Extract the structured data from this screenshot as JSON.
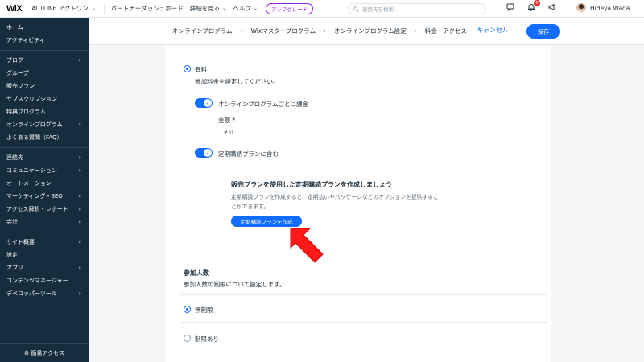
{
  "topbar": {
    "logo": "WiX",
    "site_name": "ACTONE アクトワン",
    "links": [
      "パートナーダッシュボード",
      "詳細を見る",
      "ヘルプ"
    ],
    "upgrade": "アップグレード",
    "search_placeholder": "連絡先を検索...",
    "notifications_count": "6",
    "user_name": "Hideya Wada"
  },
  "sidebar": {
    "group1": [
      "ホーム",
      "アクティビティ"
    ],
    "group2": [
      {
        "label": "ブログ",
        "arrow": true
      },
      {
        "label": "グループ",
        "arrow": false
      },
      {
        "label": "販売プラン",
        "arrow": false
      },
      {
        "label": "サブスクリプション",
        "arrow": false
      },
      {
        "label": "特典プログラム",
        "arrow": false
      },
      {
        "label": "オンラインプログラム",
        "arrow": true
      },
      {
        "label": "よくある質問（FAQ）",
        "arrow": false
      }
    ],
    "group3": [
      {
        "label": "連絡先",
        "arrow": true
      },
      {
        "label": "コミュニケーション",
        "arrow": true
      },
      {
        "label": "オートメーション",
        "arrow": false
      },
      {
        "label": "マーケティング・SEO",
        "arrow": true
      },
      {
        "label": "アクセス解析・レポート",
        "arrow": true
      },
      {
        "label": "会計",
        "arrow": true
      }
    ],
    "group4": [
      {
        "label": "サイト概要",
        "arrow": true
      },
      {
        "label": "設定",
        "arrow": false
      },
      {
        "label": "アプリ",
        "arrow": true
      },
      {
        "label": "コンテンツマネージャー",
        "arrow": false
      },
      {
        "label": "デベロッパーツール",
        "arrow": true
      }
    ],
    "quick_access": "簡易アクセス"
  },
  "breadcrumb": [
    "オンラインプログラム",
    "Wixマスタープログラム",
    "オンラインプログラム設定",
    "料金・アクセス"
  ],
  "actions": {
    "cancel": "キャンセル",
    "save": "保存"
  },
  "pricing": {
    "paid_label": "有料",
    "paid_desc": "参加料金を設定してください。",
    "per_program_label": "オンラインプログラムごとに課金",
    "amount_label": "金額 *",
    "amount_value": "¥ 0",
    "include_plan_label": "定期購読プランに含む",
    "plan_title": "販売プランを使用した定期購読プランを作成しましょう",
    "plan_desc_line1": "定期購読プランを作成すると、定期払いやパッケージなどのオプションを提供するこ",
    "plan_desc_line2": "とができます。",
    "plan_button": "定期購読プランを作成"
  },
  "participants": {
    "title": "参加人数",
    "desc": "参加人数の制限について設定します。",
    "unlimited": "無制限",
    "limited": "制限あり"
  }
}
